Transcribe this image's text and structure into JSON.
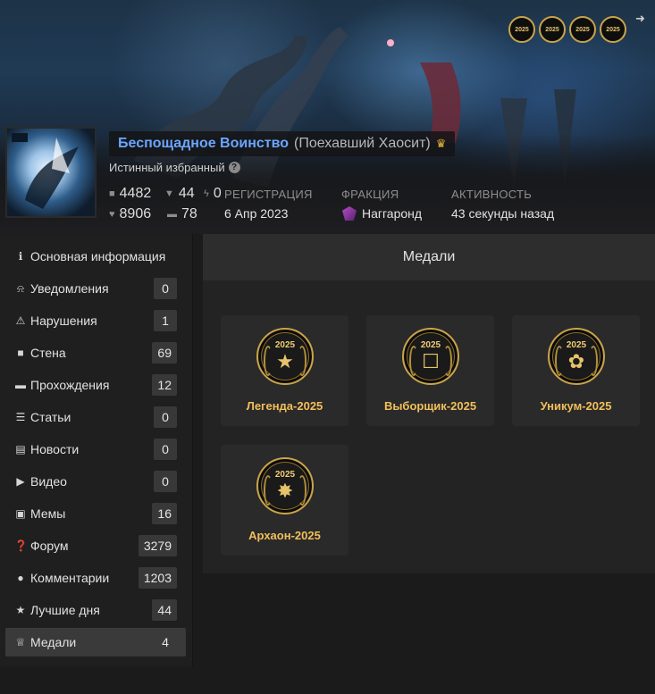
{
  "header": {
    "username": "Беспощадное Воинство",
    "nickname": "(Поехавший Хаосит)",
    "crown_icon": "crown-icon",
    "user_title": "Истинный избранный",
    "banner_medals": [
      "2025",
      "2025",
      "2025",
      "2025"
    ]
  },
  "stats": {
    "comments": "4482",
    "dislikes": "44",
    "karma": "0",
    "likes": "8906",
    "games": "78"
  },
  "meta": {
    "registration_label": "РЕГИСТРАЦИЯ",
    "registration_value": "6 Апр 2023",
    "faction_label": "ФРАКЦИЯ",
    "faction_value": "Наггаронд",
    "activity_label": "АКТИВНОСТЬ",
    "activity_value": "43 секунды назад"
  },
  "sidebar": {
    "items": [
      {
        "label": "Основная информация",
        "icon": "info-icon",
        "count": ""
      },
      {
        "label": "Уведомления",
        "icon": "bell-icon",
        "count": "0"
      },
      {
        "label": "Нарушения",
        "icon": "warning-icon",
        "count": "1"
      },
      {
        "label": "Стена",
        "icon": "comments-icon",
        "count": "69"
      },
      {
        "label": "Прохождения",
        "icon": "gamepad-icon",
        "count": "12"
      },
      {
        "label": "Статьи",
        "icon": "document-icon",
        "count": "0"
      },
      {
        "label": "Новости",
        "icon": "newspaper-icon",
        "count": "0"
      },
      {
        "label": "Видео",
        "icon": "video-icon",
        "count": "0"
      },
      {
        "label": "Мемы",
        "icon": "image-icon",
        "count": "16"
      },
      {
        "label": "Форум",
        "icon": "question-icon",
        "count": "3279"
      },
      {
        "label": "Комментарии",
        "icon": "comment-icon",
        "count": "1203"
      },
      {
        "label": "Лучшие дня",
        "icon": "star-icon",
        "count": "44"
      },
      {
        "label": "Медали",
        "icon": "trophy-icon",
        "count": "4"
      }
    ]
  },
  "main": {
    "title": "Медали",
    "medals": [
      {
        "name": "Легенда-2025",
        "year": "2025",
        "symbol": "star-icon"
      },
      {
        "name": "Выборщик-2025",
        "year": "2025",
        "symbol": "ballot-icon"
      },
      {
        "name": "Уникум-2025",
        "year": "2025",
        "symbol": "brain-icon"
      },
      {
        "name": "Архаон-2025",
        "year": "2025",
        "symbol": "chaos-star-icon"
      }
    ]
  },
  "colors": {
    "accent_name": "#6aa6ff",
    "medal_gold": "#f2bf5a",
    "background": "#1b1b1b"
  }
}
